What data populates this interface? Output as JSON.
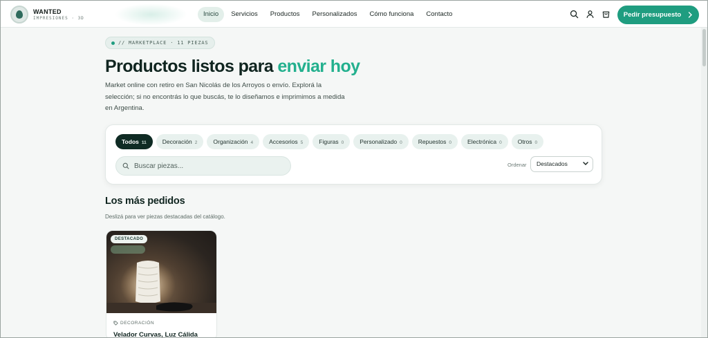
{
  "brand": {
    "name": "WANTED",
    "subtitle": "IMPRESIONES · 3D"
  },
  "nav": {
    "items": [
      {
        "label": "Inicio",
        "active": true
      },
      {
        "label": "Servicios",
        "active": false
      },
      {
        "label": "Productos",
        "active": false
      },
      {
        "label": "Personalizados",
        "active": false
      },
      {
        "label": "Cómo funciona",
        "active": false
      },
      {
        "label": "Contacto",
        "active": false
      }
    ],
    "cta_label": "Pedir presupuesto"
  },
  "icons": {
    "search": "search-icon",
    "account": "user-icon",
    "cart": "cart-icon",
    "cta_arrow": "chevron-right-icon"
  },
  "hero": {
    "tag": "// MARKETPLACE · 11 PIEZAS",
    "title_main": "Productos listos para ",
    "title_accent": "enviar hoy",
    "description": "Market online con retiro en San Nicolás de los Arroyos o envío. Explorá la selección; si no encontrás lo que buscás, te lo diseñamos e imprimimos a medida en Argentina."
  },
  "filters": {
    "categories": [
      {
        "label": "Todos",
        "count": "11",
        "active": true
      },
      {
        "label": "Decoración",
        "count": "2",
        "active": false
      },
      {
        "label": "Organización",
        "count": "4",
        "active": false
      },
      {
        "label": "Accesorios",
        "count": "5",
        "active": false
      },
      {
        "label": "Figuras",
        "count": "0",
        "active": false
      },
      {
        "label": "Personalizado",
        "count": "0",
        "active": false
      },
      {
        "label": "Repuestos",
        "count": "0",
        "active": false
      },
      {
        "label": "Electrónica",
        "count": "0",
        "active": false
      },
      {
        "label": "Otros",
        "count": "0",
        "active": false
      }
    ],
    "search_placeholder": "Buscar piezas...",
    "sort_label": "Ordenar",
    "sort_value": "Destacados"
  },
  "section": {
    "title": "Los más pedidos",
    "subtitle": "Deslizá para ver piezas destacadas del catálogo."
  },
  "featured_card": {
    "badge": "DESTACADO",
    "category": "DECORACIÓN",
    "name": "Velador Curvas, Luz Cálida"
  },
  "colors": {
    "accent": "#23b08e",
    "cta": "#1f9d80",
    "dark_chip": "#0f2b24",
    "chip_bg": "#e8f1ee"
  }
}
